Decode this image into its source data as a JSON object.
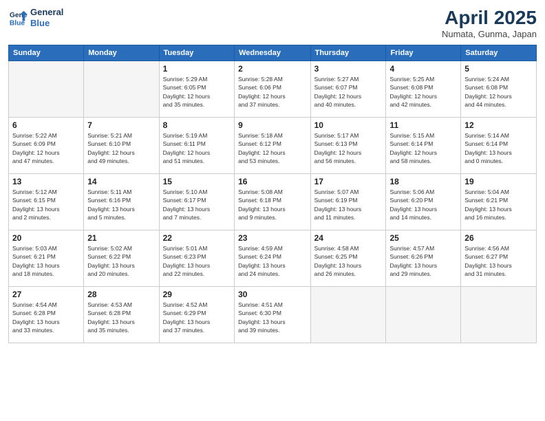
{
  "header": {
    "logo_line1": "General",
    "logo_line2": "Blue",
    "month": "April 2025",
    "location": "Numata, Gunma, Japan"
  },
  "weekdays": [
    "Sunday",
    "Monday",
    "Tuesday",
    "Wednesday",
    "Thursday",
    "Friday",
    "Saturday"
  ],
  "weeks": [
    [
      {
        "day": "",
        "info": ""
      },
      {
        "day": "",
        "info": ""
      },
      {
        "day": "1",
        "info": "Sunrise: 5:29 AM\nSunset: 6:05 PM\nDaylight: 12 hours\nand 35 minutes."
      },
      {
        "day": "2",
        "info": "Sunrise: 5:28 AM\nSunset: 6:06 PM\nDaylight: 12 hours\nand 37 minutes."
      },
      {
        "day": "3",
        "info": "Sunrise: 5:27 AM\nSunset: 6:07 PM\nDaylight: 12 hours\nand 40 minutes."
      },
      {
        "day": "4",
        "info": "Sunrise: 5:25 AM\nSunset: 6:08 PM\nDaylight: 12 hours\nand 42 minutes."
      },
      {
        "day": "5",
        "info": "Sunrise: 5:24 AM\nSunset: 6:08 PM\nDaylight: 12 hours\nand 44 minutes."
      }
    ],
    [
      {
        "day": "6",
        "info": "Sunrise: 5:22 AM\nSunset: 6:09 PM\nDaylight: 12 hours\nand 47 minutes."
      },
      {
        "day": "7",
        "info": "Sunrise: 5:21 AM\nSunset: 6:10 PM\nDaylight: 12 hours\nand 49 minutes."
      },
      {
        "day": "8",
        "info": "Sunrise: 5:19 AM\nSunset: 6:11 PM\nDaylight: 12 hours\nand 51 minutes."
      },
      {
        "day": "9",
        "info": "Sunrise: 5:18 AM\nSunset: 6:12 PM\nDaylight: 12 hours\nand 53 minutes."
      },
      {
        "day": "10",
        "info": "Sunrise: 5:17 AM\nSunset: 6:13 PM\nDaylight: 12 hours\nand 56 minutes."
      },
      {
        "day": "11",
        "info": "Sunrise: 5:15 AM\nSunset: 6:14 PM\nDaylight: 12 hours\nand 58 minutes."
      },
      {
        "day": "12",
        "info": "Sunrise: 5:14 AM\nSunset: 6:14 PM\nDaylight: 13 hours\nand 0 minutes."
      }
    ],
    [
      {
        "day": "13",
        "info": "Sunrise: 5:12 AM\nSunset: 6:15 PM\nDaylight: 13 hours\nand 2 minutes."
      },
      {
        "day": "14",
        "info": "Sunrise: 5:11 AM\nSunset: 6:16 PM\nDaylight: 13 hours\nand 5 minutes."
      },
      {
        "day": "15",
        "info": "Sunrise: 5:10 AM\nSunset: 6:17 PM\nDaylight: 13 hours\nand 7 minutes."
      },
      {
        "day": "16",
        "info": "Sunrise: 5:08 AM\nSunset: 6:18 PM\nDaylight: 13 hours\nand 9 minutes."
      },
      {
        "day": "17",
        "info": "Sunrise: 5:07 AM\nSunset: 6:19 PM\nDaylight: 13 hours\nand 11 minutes."
      },
      {
        "day": "18",
        "info": "Sunrise: 5:06 AM\nSunset: 6:20 PM\nDaylight: 13 hours\nand 14 minutes."
      },
      {
        "day": "19",
        "info": "Sunrise: 5:04 AM\nSunset: 6:21 PM\nDaylight: 13 hours\nand 16 minutes."
      }
    ],
    [
      {
        "day": "20",
        "info": "Sunrise: 5:03 AM\nSunset: 6:21 PM\nDaylight: 13 hours\nand 18 minutes."
      },
      {
        "day": "21",
        "info": "Sunrise: 5:02 AM\nSunset: 6:22 PM\nDaylight: 13 hours\nand 20 minutes."
      },
      {
        "day": "22",
        "info": "Sunrise: 5:01 AM\nSunset: 6:23 PM\nDaylight: 13 hours\nand 22 minutes."
      },
      {
        "day": "23",
        "info": "Sunrise: 4:59 AM\nSunset: 6:24 PM\nDaylight: 13 hours\nand 24 minutes."
      },
      {
        "day": "24",
        "info": "Sunrise: 4:58 AM\nSunset: 6:25 PM\nDaylight: 13 hours\nand 26 minutes."
      },
      {
        "day": "25",
        "info": "Sunrise: 4:57 AM\nSunset: 6:26 PM\nDaylight: 13 hours\nand 29 minutes."
      },
      {
        "day": "26",
        "info": "Sunrise: 4:56 AM\nSunset: 6:27 PM\nDaylight: 13 hours\nand 31 minutes."
      }
    ],
    [
      {
        "day": "27",
        "info": "Sunrise: 4:54 AM\nSunset: 6:28 PM\nDaylight: 13 hours\nand 33 minutes."
      },
      {
        "day": "28",
        "info": "Sunrise: 4:53 AM\nSunset: 6:28 PM\nDaylight: 13 hours\nand 35 minutes."
      },
      {
        "day": "29",
        "info": "Sunrise: 4:52 AM\nSunset: 6:29 PM\nDaylight: 13 hours\nand 37 minutes."
      },
      {
        "day": "30",
        "info": "Sunrise: 4:51 AM\nSunset: 6:30 PM\nDaylight: 13 hours\nand 39 minutes."
      },
      {
        "day": "",
        "info": ""
      },
      {
        "day": "",
        "info": ""
      },
      {
        "day": "",
        "info": ""
      }
    ]
  ]
}
